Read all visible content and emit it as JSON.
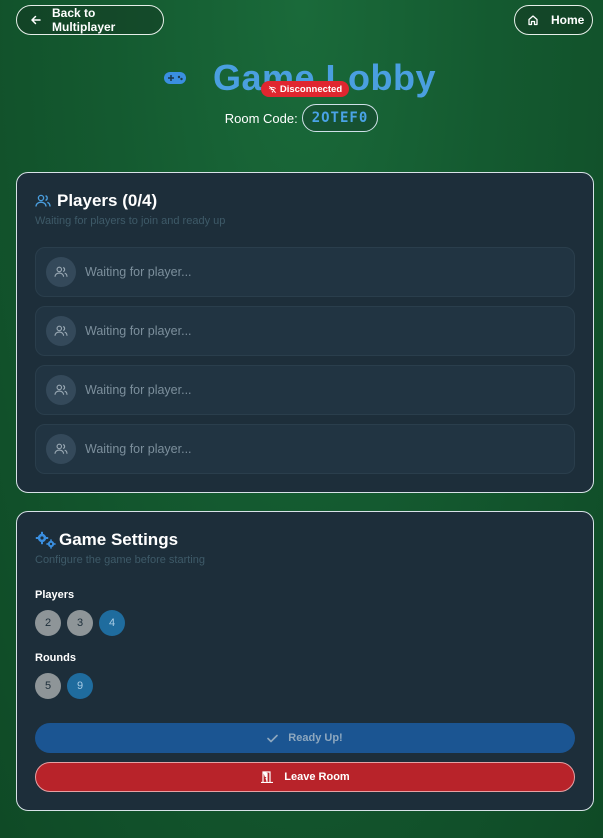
{
  "nav": {
    "back_label": "Back to Multiplayer",
    "home_label": "Home"
  },
  "header": {
    "title": "Game Lobby",
    "room_code_label": "Room Code:",
    "room_code": "2OTEF0",
    "connection_status": "Disconnected"
  },
  "players": {
    "title": "Players (0/4)",
    "subtitle": "Waiting for players to join and ready up",
    "slots": [
      {
        "label": "Waiting for player..."
      },
      {
        "label": "Waiting for player..."
      },
      {
        "label": "Waiting for player..."
      },
      {
        "label": "Waiting for player..."
      }
    ]
  },
  "settings": {
    "title": "Game Settings",
    "subtitle": "Configure the game before starting",
    "players_label": "Players",
    "player_options": [
      "2",
      "3",
      "4"
    ],
    "players_selected": "4",
    "rounds_label": "Rounds",
    "round_options": [
      "5",
      "9"
    ],
    "rounds_selected": "9"
  },
  "actions": {
    "ready_label": "Ready Up!",
    "leave_label": "Leave Room"
  },
  "colors": {
    "accent": "#4a9fe0",
    "status_disconnected": "#e0262f",
    "leave": "#b8232a",
    "ready": "#1b5592"
  }
}
